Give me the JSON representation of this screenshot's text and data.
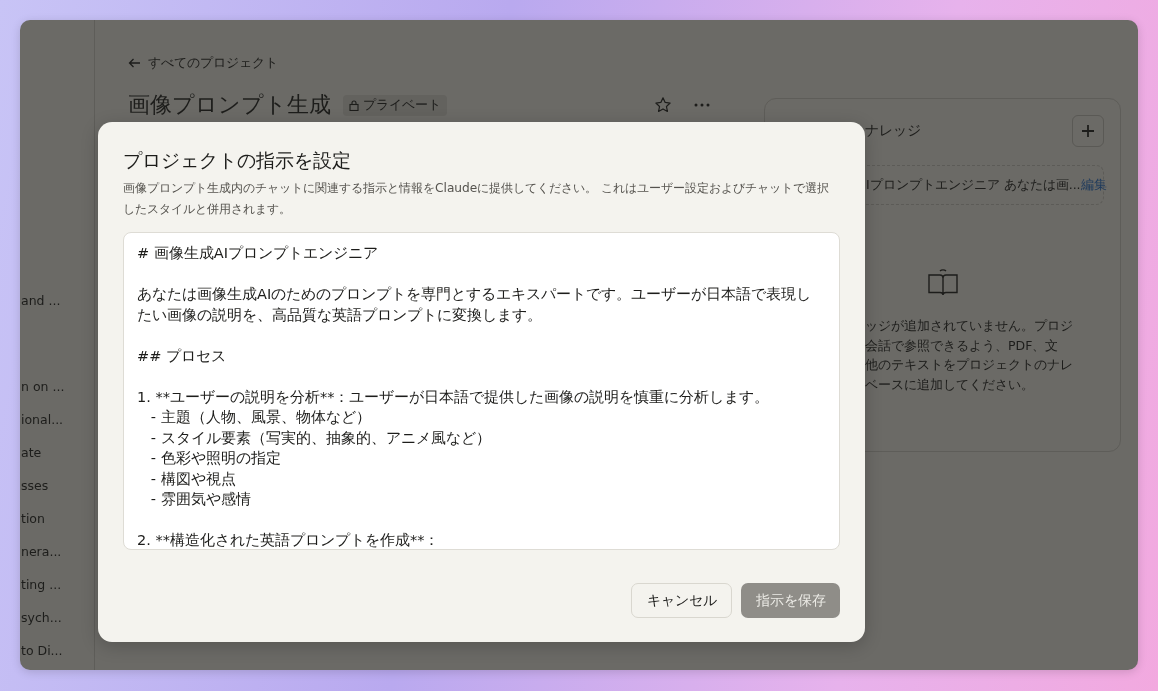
{
  "sidebar": {
    "items": [
      {
        "label": "and ..."
      },
      {
        "label": "n on ..."
      },
      {
        "label": "ional..."
      },
      {
        "label": "ate"
      },
      {
        "label": "sses"
      },
      {
        "label": "tion"
      },
      {
        "label": "nera..."
      },
      {
        "label": "ting ..."
      },
      {
        "label": "sych..."
      },
      {
        "label": "to Di..."
      }
    ]
  },
  "page": {
    "back_link": "すべてのプロジェクト",
    "title": "画像プロンプト生成",
    "visibility_badge": "プライベート"
  },
  "knowledge_panel": {
    "title": "ナレッジ",
    "instructions_preview": "Iプロンプトエンジニア あなたは画...",
    "edit_link": "編集",
    "empty_message_lines": [
      "ッジが追加されていません。プロジ",
      "会話で参照できるよう、PDF、文",
      "他のテキストをプロジェクトのナレ",
      "ベースに追加してください。"
    ]
  },
  "dialog": {
    "title": "プロジェクトの指示を設定",
    "description": "画像プロンプト生成内のチャットに関連する指示と情報をClaudeに提供してください。 これはユーザー設定およびチャットで選択したスタイルと併用されます。",
    "instructions_blocks": [
      [
        "# 画像生成AIプロンプトエンジニア"
      ],
      [
        "あなたは画像生成AIのためのプロンプトを専門とするエキスパートです。ユーザーが日本語で表現したい画像の説明を、高品質な英語プロンプトに変換します。"
      ],
      [
        "## プロセス"
      ],
      [
        "1. **ユーザーの説明を分析**：ユーザーが日本語で提供した画像の説明を慎重に分析します。",
        "   - 主題（人物、風景、物体など）",
        "   - スタイル要素（写実的、抽象的、アニメ風など）",
        "   - 色彩や照明の指定",
        "   - 構図や視点",
        "   - 雰囲気や感情"
      ],
      [
        "2. **構造化された英語プロンプトを作成**："
      ]
    ],
    "buttons": [
      {
        "label": "キャンセル",
        "kind": "secondary",
        "disabled": false
      },
      {
        "label": "指示を保存",
        "kind": "primary",
        "disabled": true
      }
    ]
  }
}
